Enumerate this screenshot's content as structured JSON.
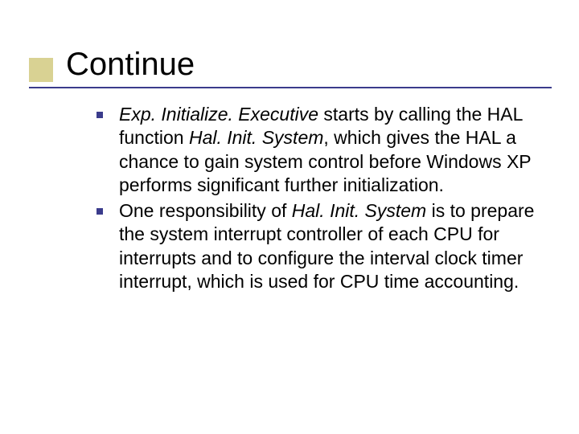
{
  "title": "Continue",
  "bullets": [
    {
      "runs": [
        {
          "text": "Exp. Initialize. Executive",
          "italic": true
        },
        {
          "text": " starts by calling the HAL function ",
          "italic": false
        },
        {
          "text": "Hal. Init. System",
          "italic": true
        },
        {
          "text": ", which gives the HAL a chance to gain system control before Windows XP performs significant further initialization.",
          "italic": false
        }
      ]
    },
    {
      "runs": [
        {
          "text": "One responsibility of ",
          "italic": false
        },
        {
          "text": "Hal. Init. System",
          "italic": true
        },
        {
          "text": " is to prepare the system interrupt controller of each CPU for interrupts and to configure the interval clock timer interrupt, which is used for CPU time accounting.",
          "italic": false
        }
      ]
    }
  ]
}
